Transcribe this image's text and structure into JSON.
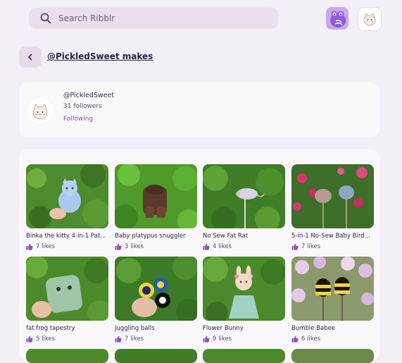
{
  "search": {
    "placeholder": "Search Ribblr"
  },
  "header": {
    "title": "@PickledSweet makes"
  },
  "profile": {
    "username": "@PickledSweet",
    "followers": "31 followers",
    "follow_state": "Following"
  },
  "items": [
    {
      "title": "Binka the kitty 4-in-1 Pat...",
      "likes": "7 likes"
    },
    {
      "title": "Baby platypus snuggler",
      "likes": "3 likes"
    },
    {
      "title": "No Sew Fat Rat",
      "likes": "4 likes"
    },
    {
      "title": "5-in-1 No-Sew Baby Bird...",
      "likes": "7 likes"
    },
    {
      "title": "fat frog tapestry",
      "likes": "5 likes"
    },
    {
      "title": "Juggling balls",
      "likes": "7 likes"
    },
    {
      "title": "Flower Bunny",
      "likes": "9 likes"
    },
    {
      "title": "Bumble Babee",
      "likes": "6 likes"
    }
  ],
  "colors": {
    "accent": "#8254c8",
    "background": "#f4eff6",
    "card": "#fbf8fc",
    "search_bg": "#e9dfee"
  },
  "icons": {
    "search": "search-icon",
    "back": "chevron-left-icon",
    "like": "thumbs-up-icon"
  }
}
